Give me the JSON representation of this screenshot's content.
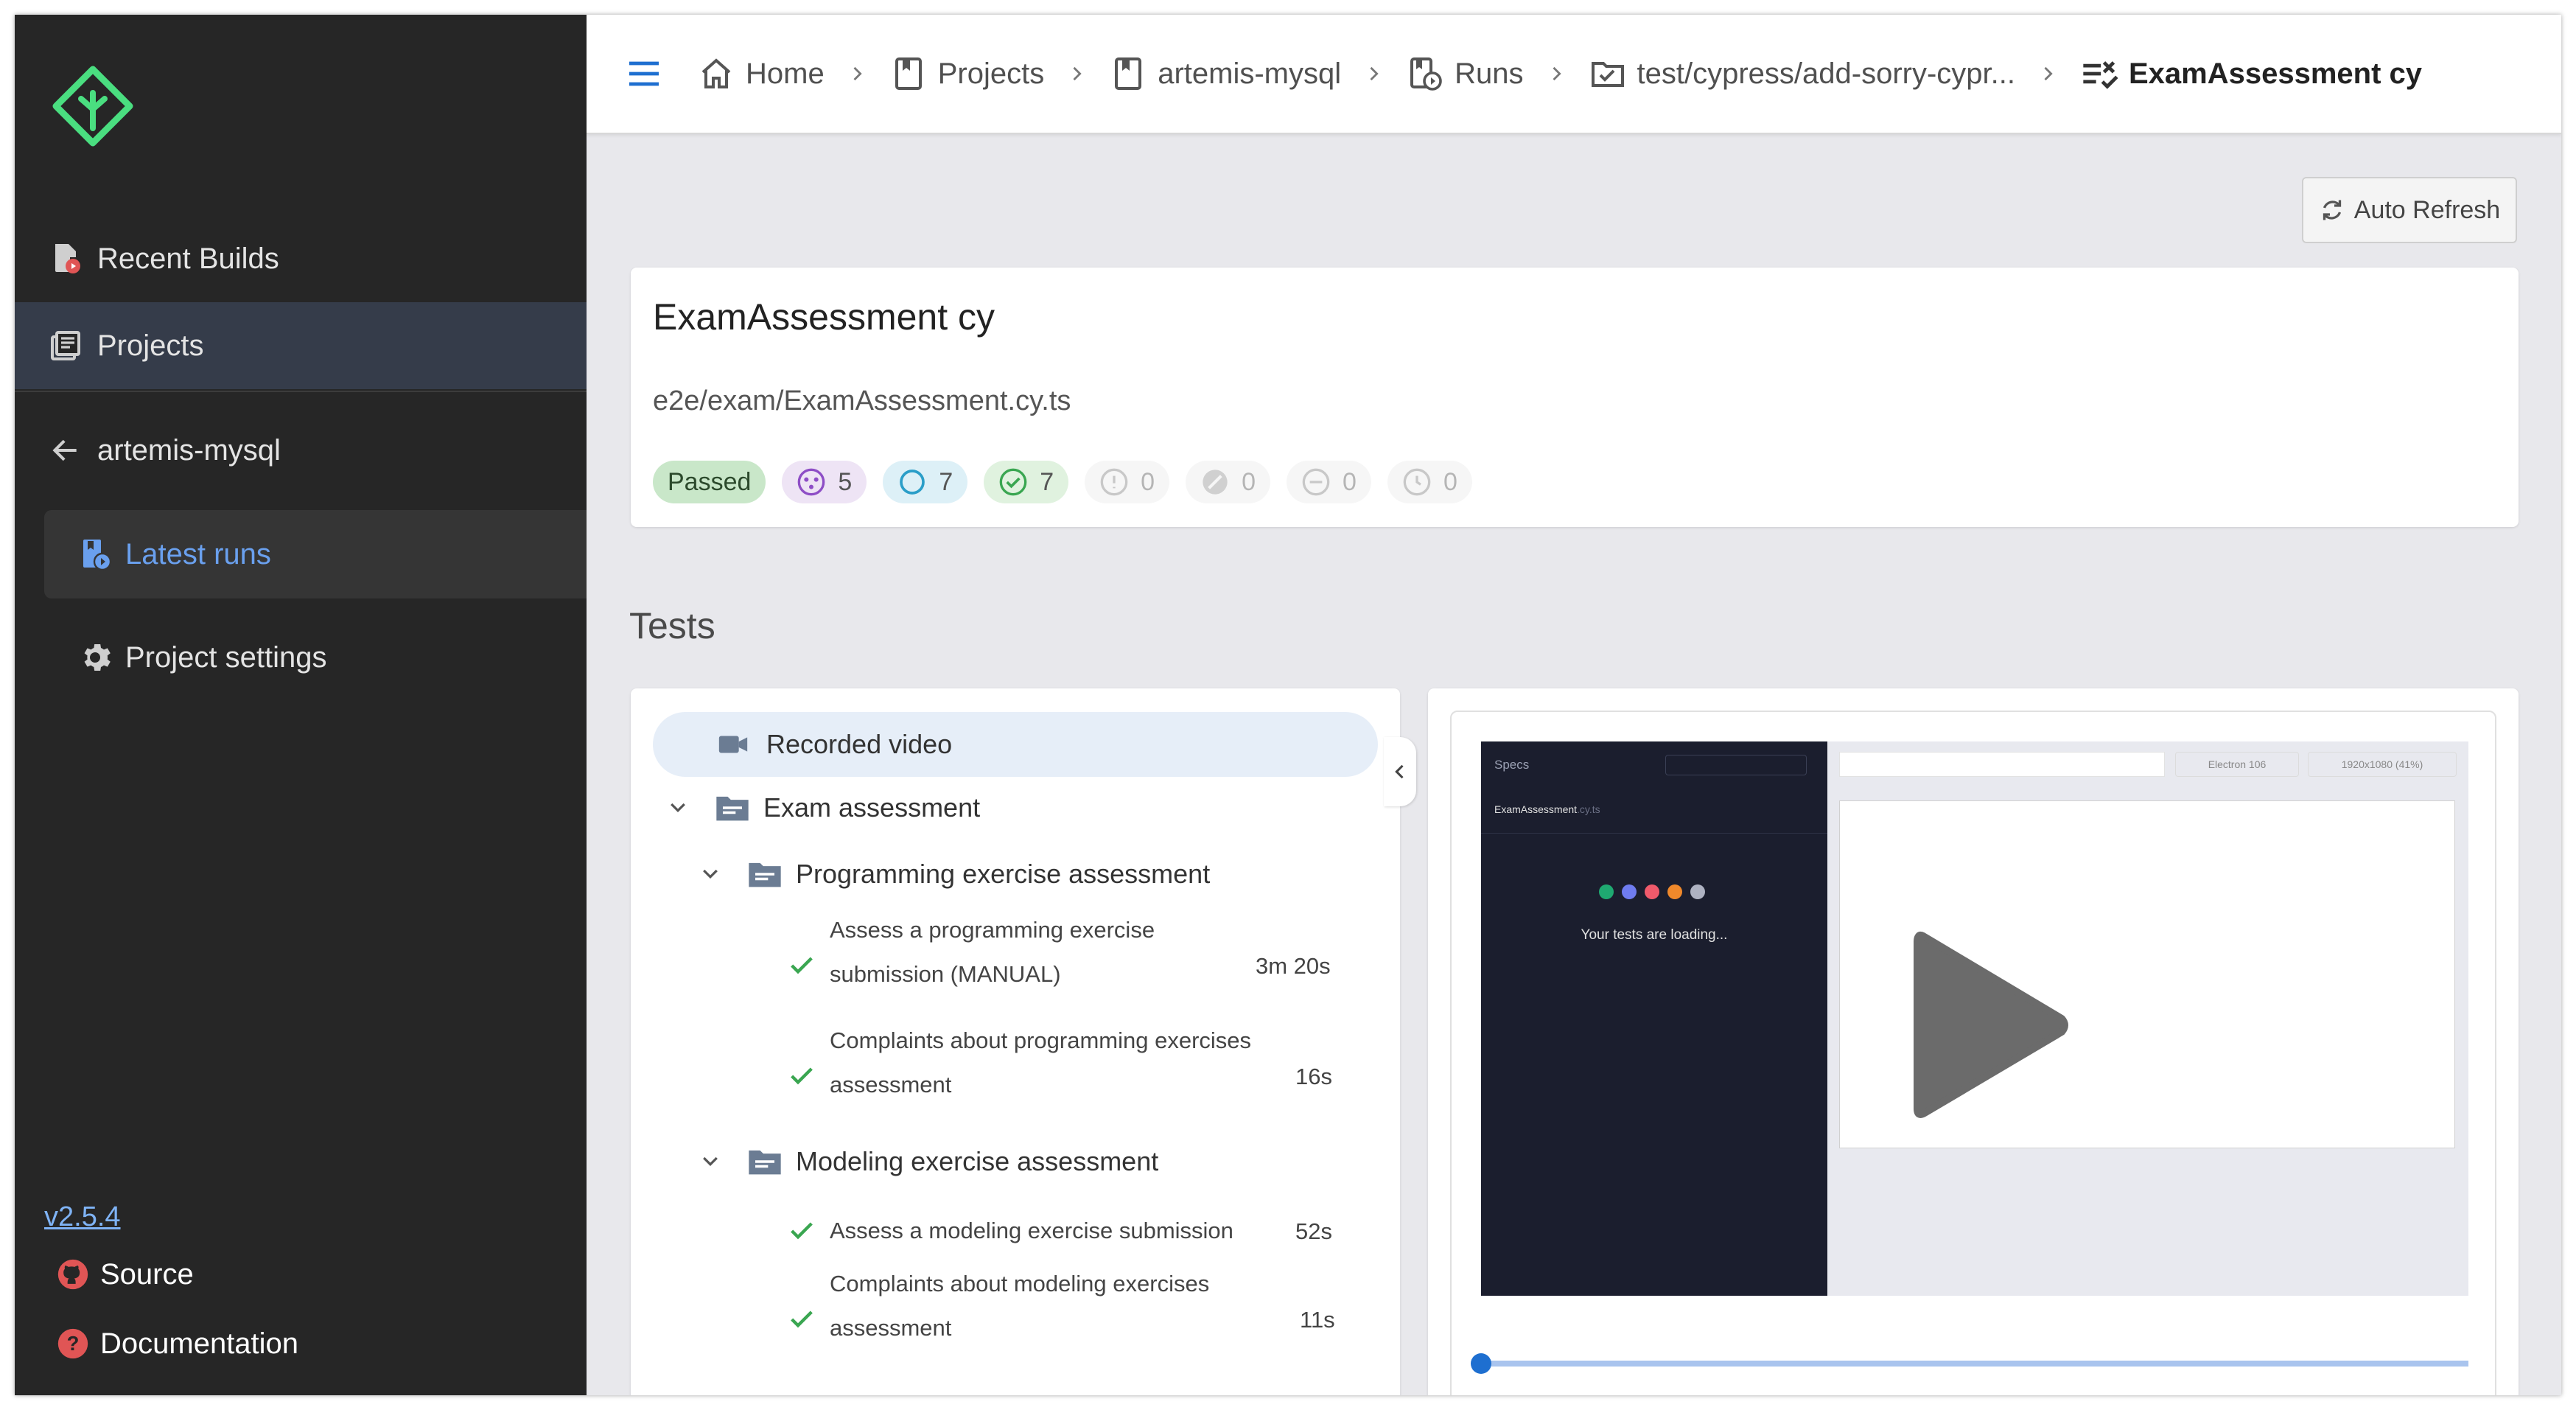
{
  "sidebar": {
    "items": [
      {
        "label": "Recent Builds",
        "icon": "build-icon"
      },
      {
        "label": "Projects",
        "icon": "library-icon"
      }
    ],
    "back": {
      "label": "artemis-mysql",
      "icon": "arrow-left-icon"
    },
    "sub_items": [
      {
        "label": "Latest runs",
        "icon": "runs-icon"
      },
      {
        "label": "Project settings",
        "icon": "gear-icon"
      }
    ],
    "version": "v2.5.4",
    "source": "Source",
    "documentation": "Documentation"
  },
  "breadcrumb": [
    {
      "label": "Home",
      "icon": "home-icon"
    },
    {
      "label": "Projects",
      "icon": "bookmark-icon"
    },
    {
      "label": "artemis-mysql",
      "icon": "bookmark-icon"
    },
    {
      "label": "Runs",
      "icon": "runs-icon"
    },
    {
      "label": "test/cypress/add-sorry-cypr...",
      "icon": "video-check-icon"
    },
    {
      "label": "ExamAssessment cy",
      "icon": "list-check-icon"
    }
  ],
  "toolbar": {
    "auto_refresh": "Auto Refresh"
  },
  "spec": {
    "title": "ExamAssessment cy",
    "path": "e2e/exam/ExamAssessment.cy.ts",
    "status": "Passed",
    "counts": {
      "flaky": "5",
      "tests": "7",
      "passes": "7",
      "failures": "0",
      "skipped": "0",
      "pending": "0",
      "retries": "0"
    }
  },
  "tests_section": {
    "title": "Tests",
    "recorded_video": "Recorded video",
    "suite": "Exam assessment",
    "groups": [
      {
        "title": "Programming exercise assessment",
        "tests": [
          {
            "lines": [
              "Assess a programming exercise",
              "submission (MANUAL)"
            ],
            "duration": "3m 20s",
            "status": "passed"
          },
          {
            "lines": [
              "Complaints about programming exercises",
              "assessment"
            ],
            "duration": "16s",
            "status": "passed"
          }
        ]
      },
      {
        "title": "Modeling exercise assessment",
        "tests": [
          {
            "lines": [
              "Assess a modeling exercise submission"
            ],
            "duration": "52s",
            "status": "passed"
          },
          {
            "lines": [
              "Complaints about modeling exercises",
              "assessment"
            ],
            "duration": "11s",
            "status": "passed"
          }
        ]
      }
    ]
  },
  "video": {
    "specs_label": "Specs",
    "spec_name": "ExamAssessment",
    "spec_ext": ".cy.ts",
    "loading": "Your tests are loading...",
    "browser": "Electron 106",
    "viewport": "1920x1080",
    "zoom": "(41%)",
    "progress": 0.0
  },
  "colors": {
    "accent": "#4ade80",
    "link": "#6aa0ee",
    "menu": "#1e6fd0",
    "pass": "#3aa651"
  }
}
